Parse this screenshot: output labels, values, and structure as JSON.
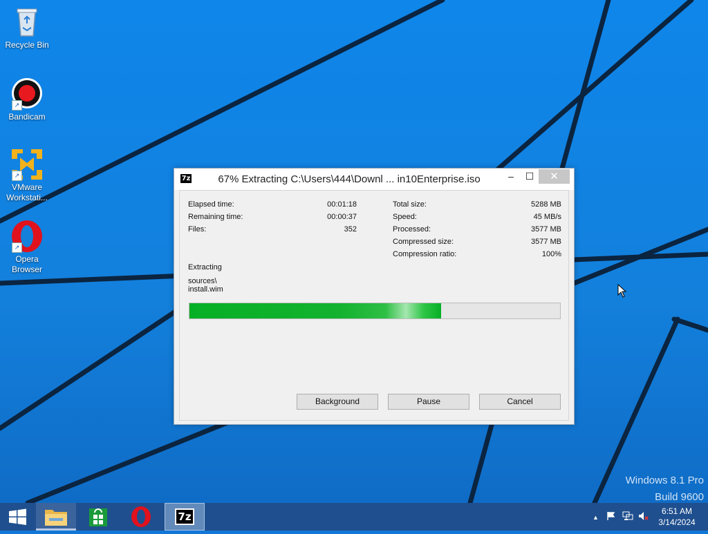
{
  "desktop": {
    "icons": [
      {
        "label": "Recycle Bin",
        "icon": "recycle-bin-icon"
      },
      {
        "label": "Bandicam",
        "icon": "bandicam-icon"
      },
      {
        "label": "VMware Workstati...",
        "icon": "vmware-icon"
      },
      {
        "label": "Opera Browser",
        "icon": "opera-icon"
      }
    ],
    "watermark": {
      "line1": "Windows 8.1 Pro",
      "line2": "Build 9600"
    }
  },
  "dialog": {
    "app_icon_text": "7z",
    "title": "67% Extracting C:\\Users\\444\\Downl ... in10Enterprise.iso",
    "controls": {
      "minimize": "–",
      "maximize": "☐",
      "close": "✕"
    },
    "left_stats": [
      {
        "label": "Elapsed time:",
        "value": "00:01:18"
      },
      {
        "label": "Remaining time:",
        "value": "00:00:37"
      },
      {
        "label": "Files:",
        "value": "352"
      }
    ],
    "right_stats": [
      {
        "label": "Total size:",
        "value": "5288 MB"
      },
      {
        "label": "Speed:",
        "value": "45 MB/s"
      },
      {
        "label": "Processed:",
        "value": "3577 MB"
      },
      {
        "label": "Compressed size:",
        "value": "3577 MB"
      },
      {
        "label": "Compression ratio:",
        "value": "100%"
      }
    ],
    "status_label": "Extracting",
    "current_path": "sources\\",
    "current_file": "install.wim",
    "progress": 0.68,
    "buttons": {
      "background": "Background",
      "pause": "Pause",
      "cancel": "Cancel"
    }
  },
  "taskbar": {
    "apps": [
      {
        "name": "file-explorer",
        "icon": "folder-icon"
      },
      {
        "name": "store",
        "icon": "store-icon"
      },
      {
        "name": "opera",
        "icon": "opera-icon"
      },
      {
        "name": "7-zip",
        "icon": "7zip-icon",
        "text": "7z"
      }
    ],
    "tray": {
      "chevron": "▲",
      "flag": "flag-icon",
      "network": "network-icon",
      "volume": "volume-muted-icon"
    },
    "clock": {
      "time": "6:51 AM",
      "date": "3/14/2024"
    }
  },
  "colors": {
    "wallpaper": "#1380dc",
    "taskbar": "#1f4f8e",
    "progress": "#06b025"
  }
}
